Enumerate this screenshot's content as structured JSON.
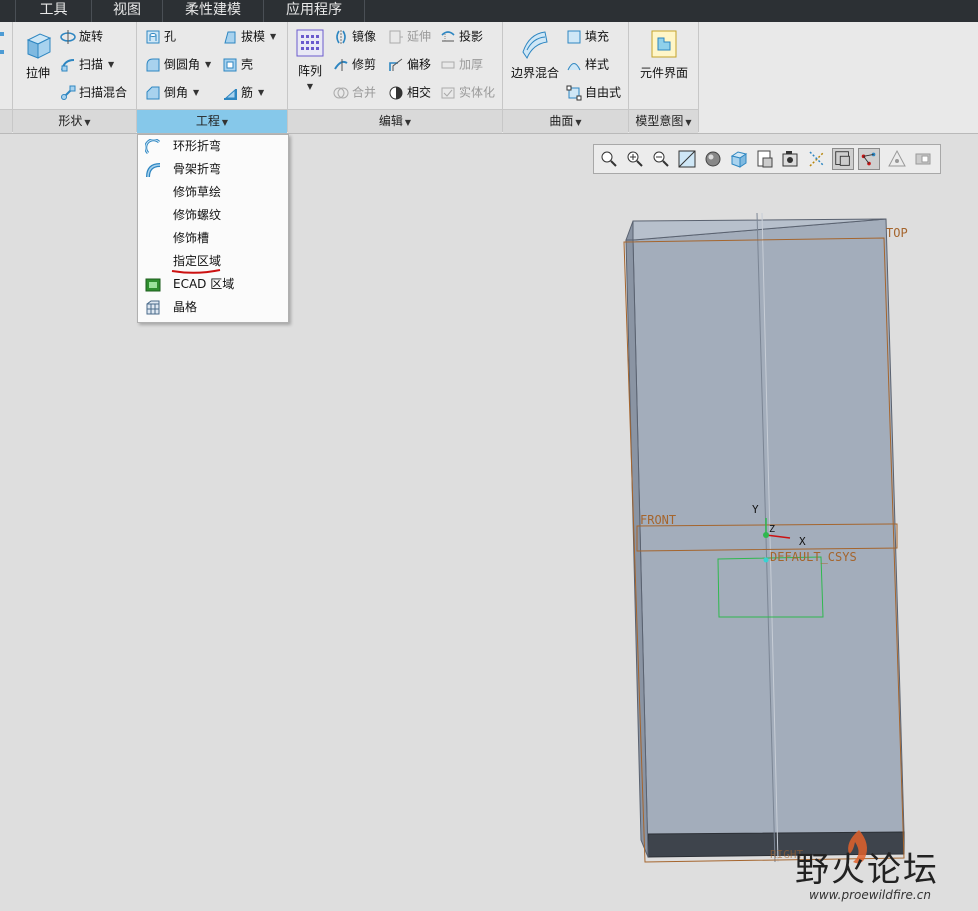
{
  "tabs": [
    "工具",
    "视图",
    "柔性建模",
    "应用程序"
  ],
  "ribbon": {
    "shape": {
      "group_label": "形状",
      "extrude": "拉伸",
      "revolve": "旋转",
      "sweep": "扫描",
      "swept_blend": "扫描混合"
    },
    "engineering": {
      "group_label": "工程",
      "hole": "孔",
      "round": "倒圆角",
      "chamfer": "倒角",
      "draft": "拔模",
      "shell": "壳",
      "rib": "筋"
    },
    "editing": {
      "group_label": "编辑",
      "pattern": "阵列",
      "mirror": "镜像",
      "trim": "修剪",
      "merge": "合并",
      "extend": "延伸",
      "offset": "偏移",
      "intersect": "相交",
      "project": "投影",
      "thicken": "加厚",
      "solidify": "实体化"
    },
    "surfaces": {
      "group_label": "曲面",
      "boundary_blend": "边界混合",
      "fill": "填充",
      "style": "样式",
      "freestyle": "自由式"
    },
    "model_intent": {
      "group_label": "模型意图",
      "component_interface": "元件界面"
    }
  },
  "menu": {
    "items": [
      "环形折弯",
      "骨架折弯",
      "修饰草绘",
      "修饰螺纹",
      "修饰槽",
      "指定区域",
      "ECAD 区域",
      "晶格"
    ],
    "highlighted_index": 5
  },
  "model": {
    "plane_top": "TOP",
    "plane_front": "FRONT",
    "plane_right": "RIGHT",
    "csys": "DEFAULT_CSYS",
    "axis_x": "X",
    "axis_y": "Y",
    "axis_z": "Z"
  },
  "watermark": {
    "title": "野火论坛",
    "url": "www.proewildfire.cn"
  },
  "colors": {
    "part_face": "#a3adbb",
    "part_edge": "#5a6270",
    "datum_plane": "#a5652d",
    "sketch_green": "#2fb84f",
    "annotation_red": "#cc1111",
    "active_group": "#86c8ea"
  }
}
